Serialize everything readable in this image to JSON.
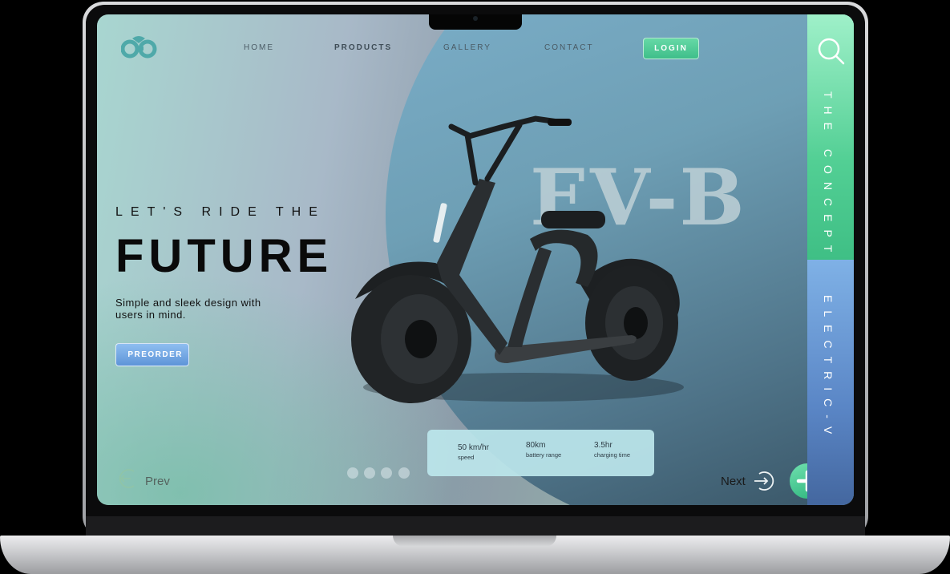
{
  "nav": {
    "items": [
      {
        "label": "HOME"
      },
      {
        "label": "PRODUCTS"
      },
      {
        "label": "GALLERY"
      },
      {
        "label": "CONTACT"
      }
    ],
    "login_label": "LOGIN"
  },
  "hero": {
    "tagline": "LET'S RIDE THE",
    "headline": "FUTURE",
    "description": "Simple and sleek design with users in mind.",
    "preorder_label": "PREORDER",
    "model_name": "EV-B"
  },
  "side": {
    "top_text": "THE CONCEPT",
    "bottom_text": "ELECTRIC-V"
  },
  "specs": [
    {
      "value": "50 km/hr",
      "label": "speed"
    },
    {
      "value": "80km",
      "label": "battery range"
    },
    {
      "value": "3.5hr",
      "label": "charging time"
    }
  ],
  "pager": {
    "prev_label": "Prev",
    "next_label": "Next",
    "dot_count": 4
  },
  "colors": {
    "accent_green": "#3fbe8a",
    "accent_blue": "#5e94d8",
    "circle_blue": "#6e9fb5"
  },
  "icons": {
    "logo": "bike-logo-icon",
    "search": "search-icon",
    "prev": "prev-arrow-icon",
    "next": "next-arrow-icon",
    "plus": "plus-icon"
  }
}
